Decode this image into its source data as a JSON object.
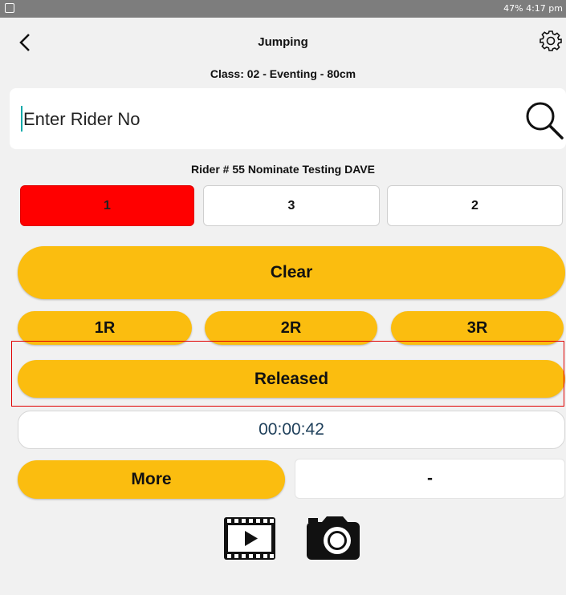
{
  "status_bar": {
    "right_text": "47% 4:17 pm"
  },
  "header": {
    "title": "Jumping",
    "subtitle": "Class: 02 - Eventing - 80cm",
    "back_icon": "chevron-left-icon",
    "settings_icon": "gear-icon"
  },
  "search": {
    "placeholder": "Enter Rider No",
    "icon": "search-icon"
  },
  "rider": {
    "label": "Rider # 55 Nominate Testing DAVE"
  },
  "positions": [
    {
      "label": "1",
      "selected": true,
      "color": "#ff0000"
    },
    {
      "label": "3",
      "selected": false
    },
    {
      "label": "2",
      "selected": false
    }
  ],
  "actions": {
    "clear_label": "Clear",
    "refusals": [
      "1R",
      "2R",
      "3R"
    ],
    "released_label": "Released",
    "timer": "00:00:42",
    "more_label": "More",
    "more_value": "-"
  },
  "media": {
    "video_icon": "video-icon",
    "camera_icon": "camera-icon"
  },
  "colors": {
    "accent": "#fbbd0f",
    "selected": "#ff0000",
    "timer_text": "#1e3f5a",
    "highlight_border": "#e00000"
  }
}
